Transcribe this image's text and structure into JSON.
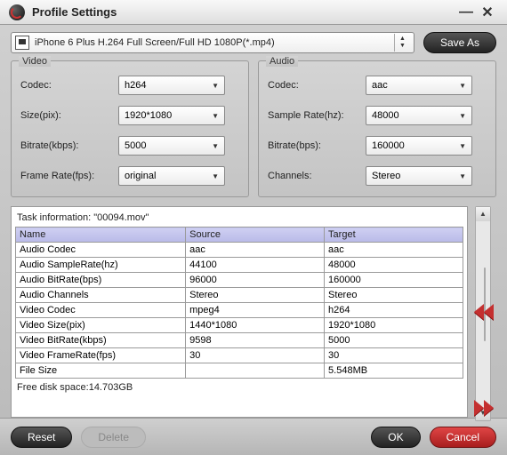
{
  "title": "Profile Settings",
  "profile": "iPhone 6 Plus H.264 Full Screen/Full HD 1080P(*.mp4)",
  "buttons": {
    "save_as": "Save As",
    "reset": "Reset",
    "delete": "Delete",
    "ok": "OK",
    "cancel": "Cancel"
  },
  "video": {
    "legend": "Video",
    "codec_label": "Codec:",
    "codec_value": "h264",
    "size_label": "Size(pix):",
    "size_value": "1920*1080",
    "bitrate_label": "Bitrate(kbps):",
    "bitrate_value": "5000",
    "framerate_label": "Frame Rate(fps):",
    "framerate_value": "original"
  },
  "audio": {
    "legend": "Audio",
    "codec_label": "Codec:",
    "codec_value": "aac",
    "samplerate_label": "Sample Rate(hz):",
    "samplerate_value": "48000",
    "bitrate_label": "Bitrate(bps):",
    "bitrate_value": "160000",
    "channels_label": "Channels:",
    "channels_value": "Stereo"
  },
  "task": {
    "title": "Task information: \"00094.mov\"",
    "headers": {
      "name": "Name",
      "source": "Source",
      "target": "Target"
    },
    "rows": [
      {
        "name": "Audio Codec",
        "source": "aac",
        "target": "aac"
      },
      {
        "name": "Audio SampleRate(hz)",
        "source": "44100",
        "target": "48000"
      },
      {
        "name": "Audio BitRate(bps)",
        "source": "96000",
        "target": "160000"
      },
      {
        "name": "Audio Channels",
        "source": "Stereo",
        "target": "Stereo"
      },
      {
        "name": "Video Codec",
        "source": "mpeg4",
        "target": "h264"
      },
      {
        "name": "Video Size(pix)",
        "source": "1440*1080",
        "target": "1920*1080"
      },
      {
        "name": "Video BitRate(kbps)",
        "source": "9598",
        "target": "5000"
      },
      {
        "name": "Video FrameRate(fps)",
        "source": "30",
        "target": "30"
      },
      {
        "name": "File Size",
        "source": "",
        "target": "5.548MB"
      }
    ],
    "free_space": "Free disk space:14.703GB"
  }
}
